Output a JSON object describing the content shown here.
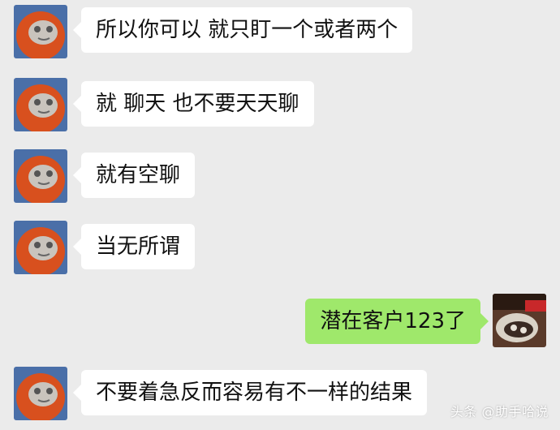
{
  "messages": [
    {
      "side": "in",
      "text": "所以你可以 就只盯一个或者两个"
    },
    {
      "side": "in",
      "text": "就 聊天 也不要天天聊"
    },
    {
      "side": "in",
      "text": "就有空聊"
    },
    {
      "side": "in",
      "text": "当无所谓"
    },
    {
      "side": "out",
      "text": "潜在客户123了"
    },
    {
      "side": "in",
      "text": "不要着急反而容易有不一样的结果"
    }
  ],
  "watermark": "头条 @助手哈说",
  "colors": {
    "background": "#ebebeb",
    "incoming_bubble": "#ffffff",
    "outgoing_bubble": "#9fe86b"
  },
  "icons": {
    "contact_avatar": "red-robot-avatar-icon",
    "self_avatar": "dark-photo-avatar-icon"
  }
}
